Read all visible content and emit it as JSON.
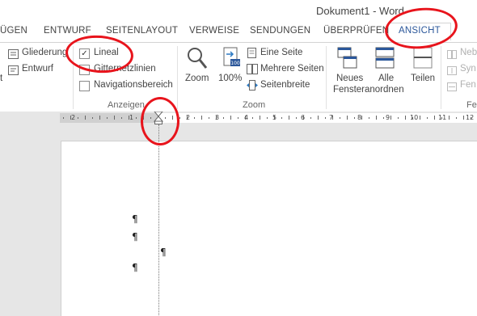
{
  "window": {
    "title": "Dokument1 - Word"
  },
  "tabs": [
    {
      "label": "ÜGEN"
    },
    {
      "label": "ENTWURF"
    },
    {
      "label": "SEITENLAYOUT"
    },
    {
      "label": "VERWEISE"
    },
    {
      "label": "SENDUNGEN"
    },
    {
      "label": "ÜBERPRÜFEN"
    },
    {
      "label": "ANSICHT",
      "active": true
    }
  ],
  "ribbon": {
    "views": {
      "gliederung": "Gliederung",
      "entwurf": "Entwurf",
      "partial_left": "t"
    },
    "anzeigen": {
      "group_label": "Anzeigen",
      "lineal": {
        "label": "Lineal",
        "checked": true
      },
      "gitternetzlinien": {
        "label": "Gitternetzlinien",
        "checked": false
      },
      "navigationsbereich": {
        "label": "Navigationsbereich",
        "checked": false
      }
    },
    "zoom": {
      "group_label": "Zoom",
      "zoom_label": "Zoom",
      "hundred_label": "100%",
      "eine_seite": "Eine Seite",
      "mehrere_seiten": "Mehrere Seiten",
      "seitenbreite": "Seitenbreite"
    },
    "fenster": {
      "neues_fenster_line1": "Neues",
      "neues_fenster_line2": "Fenster",
      "alle_anordnen_line1": "Alle",
      "alle_anordnen_line2": "anordnen",
      "teilen": "Teilen",
      "nebeneinander": "Neb",
      "synchron": "Syn",
      "fensterposition": "Fen",
      "group_label_partial": "Fe"
    }
  },
  "ruler": {
    "numbers_left": [
      "2",
      "1"
    ],
    "numbers_right": [
      "2",
      "3",
      "4",
      "5",
      "6",
      "7",
      "8",
      "9",
      "10",
      "11",
      "12"
    ]
  },
  "document": {
    "paragraph_mark": "¶"
  },
  "colors": {
    "accent": "#2b579a",
    "annotation": "#e8141c"
  }
}
